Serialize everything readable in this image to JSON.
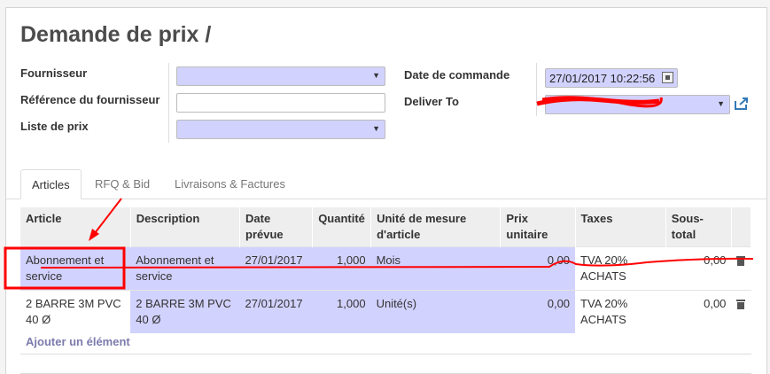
{
  "form": {
    "title": "Demande de prix /",
    "labels": {
      "vendor": "Fournisseur",
      "vendor_ref": "Référence du fournisseur",
      "pricelist": "Liste de prix",
      "order_date": "Date de commande",
      "deliver_to": "Deliver To"
    },
    "values": {
      "vendor": "",
      "vendor_ref": "",
      "pricelist": "",
      "order_date": "27/01/2017 10:22:56",
      "deliver_to": ""
    }
  },
  "tabs": [
    "Articles",
    "RFQ & Bid",
    "Livraisons & Factures"
  ],
  "table": {
    "headers": [
      "Article",
      "Description",
      "Date prévue",
      "Quantité",
      "Unité de mesure d'article",
      "Prix unitaire",
      "Taxes",
      "Sous-total"
    ],
    "rows": [
      {
        "article": "Abonnement et service",
        "description": "Abonnement et service",
        "date": "27/01/2017",
        "qty": "1,000",
        "uom": "Mois",
        "price": "0,00",
        "taxes": "TVA 20% ACHATS",
        "subtotal": "0,00"
      },
      {
        "article": "2 BARRE 3M PVC 40 Ø",
        "description": "2 BARRE 3M PVC 40 Ø",
        "date": "27/01/2017",
        "qty": "1,000",
        "uom": "Unité(s)",
        "price": "0,00",
        "taxes": "TVA 20% ACHATS",
        "subtotal": "0,00"
      }
    ],
    "add_line": "Ajouter un élément"
  },
  "colors": {
    "selected_field": "#d2d2ff",
    "link": "#7c7bad",
    "annotation": "#ff0000"
  },
  "icons": {
    "delete": "trash-icon",
    "external": "external-link-icon",
    "calendar": "calendar-icon"
  }
}
